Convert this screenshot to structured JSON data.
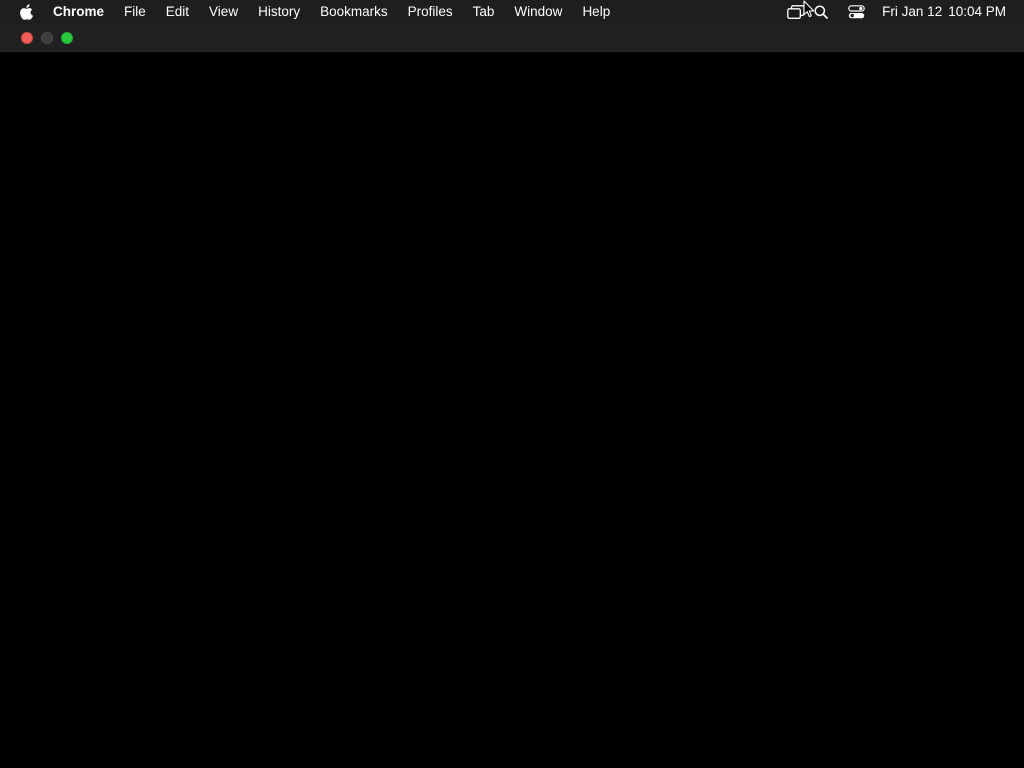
{
  "menubar": {
    "apple_icon": "apple-logo-icon",
    "app_name": "Chrome",
    "items": [
      "File",
      "Edit",
      "View",
      "History",
      "Bookmarks",
      "Profiles",
      "Tab",
      "Window",
      "Help"
    ],
    "status_icons": [
      "screen-mirroring-icon",
      "spotlight-search-icon",
      "control-center-icon"
    ],
    "clock": {
      "date": "Fri Jan 12",
      "time": "10:04 PM"
    }
  },
  "window": {
    "traffic_lights": {
      "close_color": "#ed5f58",
      "minimize_color": "#3d3d3d",
      "zoom_color": "#2bc840"
    },
    "content_background": "#000000"
  }
}
